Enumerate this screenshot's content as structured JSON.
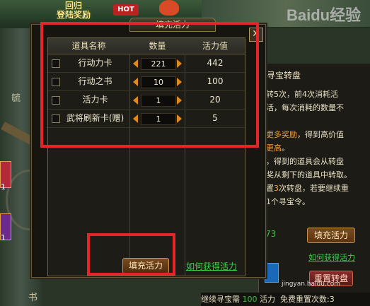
{
  "game": {
    "top_logo_line1": "回归",
    "top_logo_line2": "登陆奖励",
    "hot_badge": "HOT",
    "watermark": "Baidu经验",
    "card_counts": [
      "1",
      "1"
    ],
    "left_vertical_label": "毓",
    "left_bottom_label": "书"
  },
  "right_panel": {
    "title": "寻宝转盘",
    "lines": [
      {
        "pre": "",
        "hl": "",
        "post": "转5次，前4次消耗活"
      },
      {
        "pre": "",
        "hl": "",
        "post": "活，每次消耗的数量不"
      },
      {
        "pre": "",
        "hl": "",
        "post": ""
      },
      {
        "pre": "",
        "hl": "更多奖励",
        "post": "，得到高价值"
      },
      {
        "pre": "",
        "hl": "更高",
        "post": "。"
      },
      {
        "pre": "",
        "hl": "",
        "post": "，得到的道具会从转盘"
      },
      {
        "pre": "",
        "hl": "",
        "post": "奖从剩下的道具中转取。"
      },
      {
        "pre": "置",
        "hl": "3",
        "post": "次转盘，若要继续重"
      },
      {
        "pre": "",
        "hl": "",
        "post": "1个寻宝令。"
      }
    ],
    "green_value": "73",
    "fill_button": "填充活力",
    "how_link": "如何获得活力",
    "reset_button": "重置转盘",
    "bottom_bar": {
      "prefix": "继续寻宝需",
      "value": "100",
      "unit": "活力",
      "free_reset_label": "免费重置次数:",
      "free_reset_value": "3"
    },
    "jy_text": "jingyan.baidu.com"
  },
  "modal": {
    "title": "填充活力",
    "close_label": "✕",
    "headers": [
      "道具名称",
      "数量",
      "活力值"
    ],
    "items": [
      {
        "name": "行动力卡",
        "qty": "221",
        "vigor": "442"
      },
      {
        "name": "行动之书",
        "qty": "10",
        "vigor": "100"
      },
      {
        "name": "活力卡",
        "qty": "1",
        "vigor": "20"
      },
      {
        "name": "武将刷新卡(赠)",
        "qty": "1",
        "vigor": "5"
      }
    ],
    "fill_button": "填充活力",
    "how_link": "如何获得活力"
  }
}
